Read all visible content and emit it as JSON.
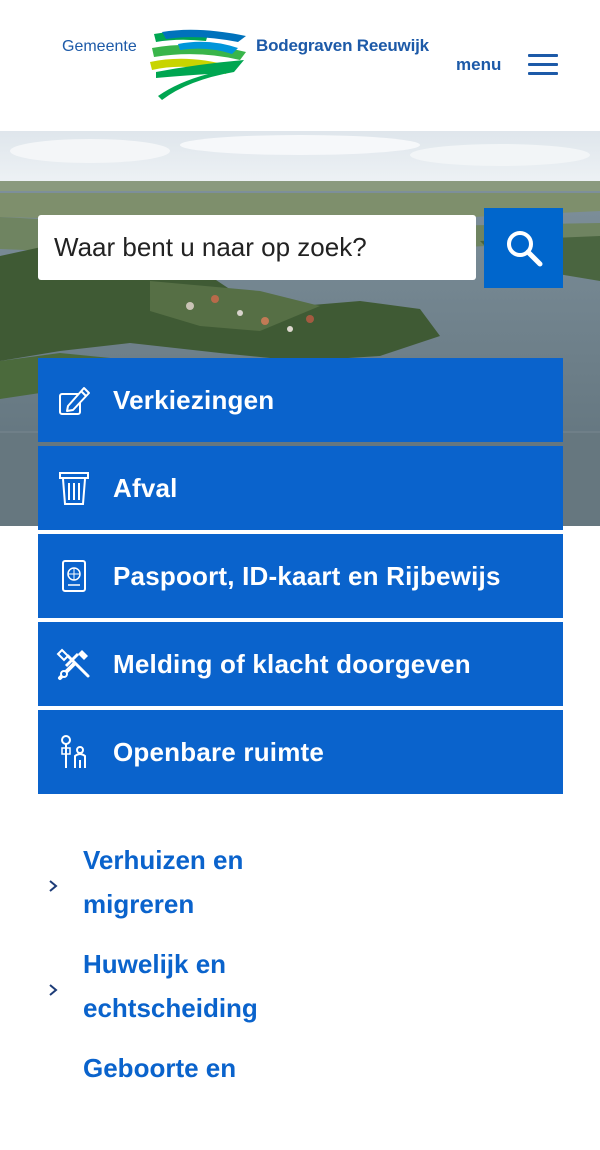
{
  "header": {
    "logo_left": "Gemeente",
    "logo_right": "Bodegraven Reeuwijk",
    "menu_label": "menu"
  },
  "search": {
    "placeholder": "Waar bent u naar op zoek?"
  },
  "tiles": [
    {
      "label": "Verkiezingen",
      "icon": "pencil-ballot-icon"
    },
    {
      "label": "Afval",
      "icon": "trash-bin-icon"
    },
    {
      "label": "Paspoort, ID-kaart en Rijbewijs",
      "icon": "passport-icon"
    },
    {
      "label": "Melding of klacht doorgeven",
      "icon": "tools-icon"
    },
    {
      "label": "Openbare ruimte",
      "icon": "public-space-icon"
    }
  ],
  "links": [
    {
      "label": "Verhuizen en migreren"
    },
    {
      "label": "Huwelijk en echtscheiding"
    },
    {
      "label": "Geboorte en"
    }
  ],
  "colors": {
    "brand_blue": "#1d5aa8",
    "tile_blue": "#0a63cc",
    "search_blue": "#0066cc"
  }
}
